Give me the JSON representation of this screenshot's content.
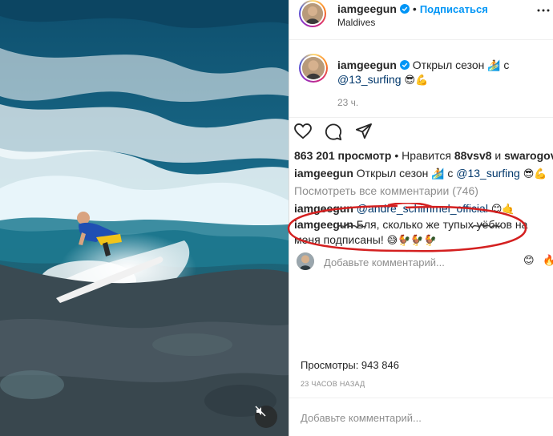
{
  "video": {
    "mute_icon": "speaker-muted-icon"
  },
  "header": {
    "username": "iamgeegun",
    "follow_label": "Подписаться",
    "location": "Maldives"
  },
  "caption": {
    "username": "iamgeegun",
    "text1": "Открыл сезон",
    "emoji1": "🏄",
    "text_c": "с",
    "mention": "@13_surfing",
    "emoji2": "😎💪",
    "time": "23 ч."
  },
  "actions": {
    "like": "heart-icon",
    "comment": "comment-icon",
    "share": "share-icon"
  },
  "stats": {
    "views": "863 201 просмотр",
    "liked_prefix": "• Нравится",
    "liked_user1": "88vsv8",
    "liked_and": "и",
    "liked_user2": "swarogov"
  },
  "preview_caption": {
    "username": "iamgeegun",
    "text": "Открыл сезон",
    "emoji1": "🏄",
    "text_c": "с",
    "mention": "@13_surfing",
    "emoji2": "😎💪"
  },
  "view_all_comments": "Посмотреть все комментарии (746)",
  "comment1": {
    "username": "iamgeegun",
    "text": "@andre_schimmel_official",
    "emoji": "😊🤙"
  },
  "comment2": {
    "username": "iamgeegun",
    "line1_text": "Бля, сколько же тупых уёбков на",
    "line2_text": "меня подписаны!",
    "line2_emoji": "😅🐓🐓🐓"
  },
  "add_comment": {
    "placeholder": "Добавьте комментарий...",
    "emoji_a": "😊",
    "emoji_b": "🔥"
  },
  "meta": {
    "views_label": "Просмотры: 943 846",
    "time_label": "23 часов назад"
  },
  "bottom_comment_placeholder": "Добавьте комментарий...",
  "colors": {
    "accent": "#0095f6",
    "annotation_red": "#d42020",
    "mention": "#00376b"
  }
}
